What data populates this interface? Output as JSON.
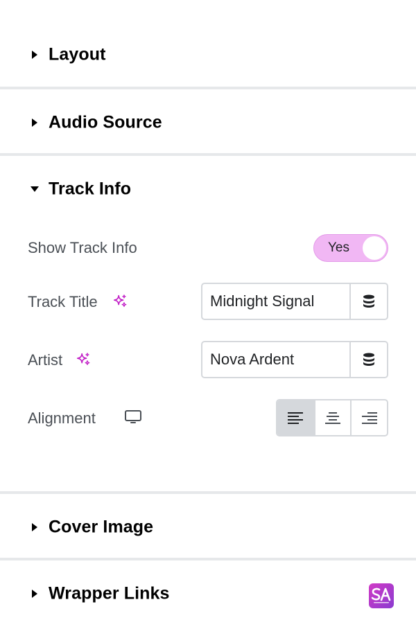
{
  "sections": {
    "layout": {
      "title": "Layout",
      "expanded": false
    },
    "audio_source": {
      "title": "Audio Source",
      "expanded": false
    },
    "track_info": {
      "title": "Track Info",
      "expanded": true
    },
    "cover_image": {
      "title": "Cover Image",
      "expanded": false
    },
    "wrapper_links": {
      "title": "Wrapper Links",
      "expanded": false
    }
  },
  "track_info": {
    "show_track_info": {
      "label": "Show Track Info",
      "toggle_text": "Yes",
      "enabled": true
    },
    "track_title": {
      "label": "Track Title",
      "value": "Midnight Signal",
      "icon": "ai-sparkle-icon",
      "action_icon": "database-icon"
    },
    "artist": {
      "label": "Artist",
      "value": "Nova Ardent",
      "icon": "ai-sparkle-icon",
      "action_icon": "database-icon"
    },
    "alignment": {
      "label": "Alignment",
      "device_icon": "desktop-monitor-icon",
      "options": [
        "left",
        "center",
        "right"
      ],
      "selected": "left"
    }
  },
  "brand": {
    "logo_text": "SA",
    "icon": "brand-logo-icon"
  },
  "colors": {
    "accent": "#c21fc7",
    "toggle_bg": "#f1b7f4",
    "border": "#d5d8dc",
    "divider": "#e6e8ea",
    "active_align": "#d5d8dc"
  }
}
